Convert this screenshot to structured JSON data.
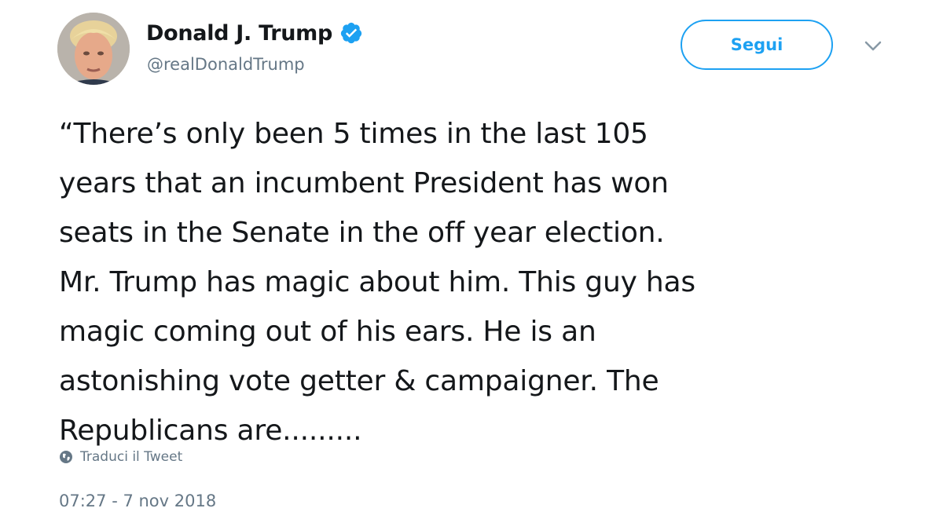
{
  "author": {
    "display_name": "Donald J. Trump",
    "handle": "@realDonaldTrump",
    "verified_icon": "verified-badge-icon",
    "verified_color": "#1da1f2"
  },
  "follow_button": {
    "label": "Segui",
    "color": "#1da1f2"
  },
  "more_menu": {
    "icon": "chevron-down-icon"
  },
  "tweet": {
    "lines": [
      "“There’s only been 5 times in the last 105",
      "years that an incumbent President has won",
      "seats in the Senate in the off year election.",
      "Mr. Trump has magic about him. This guy has",
      "magic coming out of his ears. He is an",
      "astonishing vote getter & campaigner. The",
      "Republicans are........."
    ]
  },
  "translate": {
    "icon": "globe-icon",
    "label": "Traduci il Tweet"
  },
  "timestamp": "07:27 - 7 nov 2018"
}
